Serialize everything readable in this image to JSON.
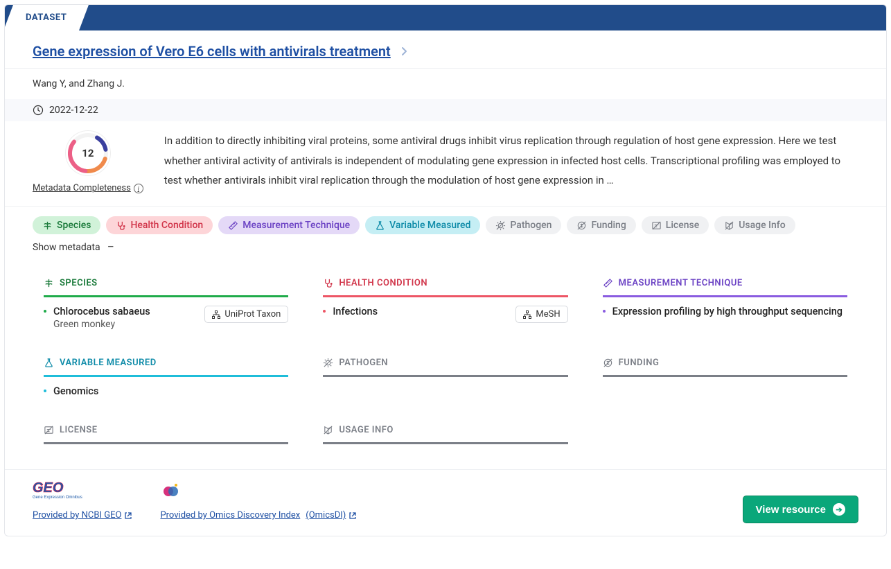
{
  "banner_label": "DATASET",
  "title": "Gene expression of Vero E6 cells with antivirals treatment",
  "authors": "Wang Y, and Zhang J.",
  "date": "2022-12-22",
  "ring_value": "12",
  "mc_label": "Metadata Completeness",
  "description": "In addition to directly inhibiting viral proteins, some antiviral drugs inhibit virus replication through regulation of host gene expression. Here we test whether antiviral activity of antivirals is independent of modulating gene expression in infected host cells. Transcriptional profiling was employed to test whether antivirals inhibit viral replication through the modulation of host gene expression in …",
  "pills": {
    "species": "Species",
    "health": "Health Condition",
    "measure": "Measurement Technique",
    "variable": "Variable Measured",
    "pathogen": "Pathogen",
    "funding": "Funding",
    "license": "License",
    "usage": "Usage Info"
  },
  "show_meta": "Show metadata",
  "sections": {
    "species": {
      "hdr": "SPECIES",
      "primary": "Chlorocebus sabaeus",
      "secondary": "Green monkey",
      "tag": "UniProt Taxon"
    },
    "health": {
      "hdr": "HEALTH CONDITION",
      "primary": "Infections",
      "tag": "MeSH"
    },
    "measure": {
      "hdr": "MEASUREMENT TECHNIQUE",
      "primary": "Expression profiling by high throughput sequencing"
    },
    "variable": {
      "hdr": "VARIABLE MEASURED",
      "primary": "Genomics"
    },
    "pathogen": {
      "hdr": "PATHOGEN"
    },
    "funding": {
      "hdr": "FUNDING"
    },
    "license": {
      "hdr": "LICENSE"
    },
    "usage": {
      "hdr": "USAGE INFO"
    }
  },
  "providers": {
    "p1": "Provided by NCBI GEO",
    "p2a": "Provided by Omics Discovery Index",
    "p2b": "(OmicsDI)"
  },
  "view_btn": "View resource"
}
